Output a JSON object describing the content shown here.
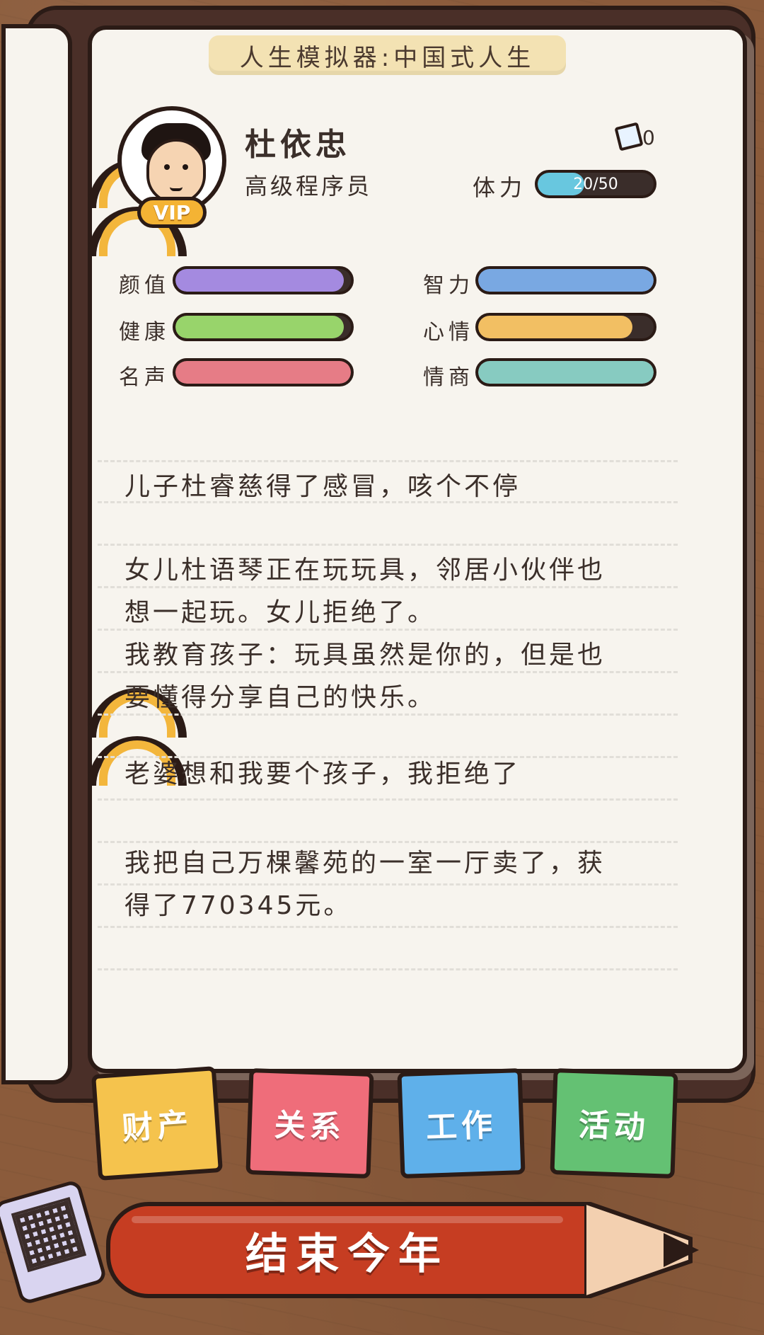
{
  "app": {
    "title": "人生模拟器:中国式人生"
  },
  "profile": {
    "name": "杜依忠",
    "job": "高级程序员",
    "vip_label": "VIP",
    "tickets": "0"
  },
  "stamina": {
    "label": "体力",
    "text": "20/50",
    "value": 20,
    "max": 50,
    "color": "#68c7df"
  },
  "attributes": [
    {
      "label": "颜值",
      "fill": 0.96,
      "color": "#a48ae0"
    },
    {
      "label": "智力",
      "fill": 1.0,
      "color": "#79a8e2"
    },
    {
      "label": "健康",
      "fill": 0.96,
      "color": "#98d46b"
    },
    {
      "label": "心情",
      "fill": 0.88,
      "color": "#f2bf63"
    },
    {
      "label": "名声",
      "fill": 1.0,
      "color": "#e67c86"
    },
    {
      "label": "情商",
      "fill": 1.0,
      "color": "#87cbc1"
    }
  ],
  "journal": {
    "entries": [
      {
        "lines": [
          "儿子杜睿慈得了感冒，咳个不停"
        ]
      },
      {
        "lines": [
          "女儿杜语琴正在玩玩具，邻居小伙伴也",
          "想一起玩。女儿拒绝了。",
          "我教育孩子：玩具虽然是你的，但是也",
          "要懂得分享自己的快乐。"
        ]
      },
      {
        "lines": [
          "老婆想和我要个孩子，我拒绝了"
        ]
      },
      {
        "lines": [
          "我把自己万棵馨苑的一室一厅卖了，获",
          "得了770345元。"
        ]
      }
    ]
  },
  "tabs": [
    {
      "label": "财产",
      "color": "#f5c34d"
    },
    {
      "label": "关系",
      "color": "#ef6d7a"
    },
    {
      "label": "工作",
      "color": "#5fb0ea"
    },
    {
      "label": "活动",
      "color": "#64c173"
    }
  ],
  "actions": {
    "end_year": "结束今年"
  }
}
